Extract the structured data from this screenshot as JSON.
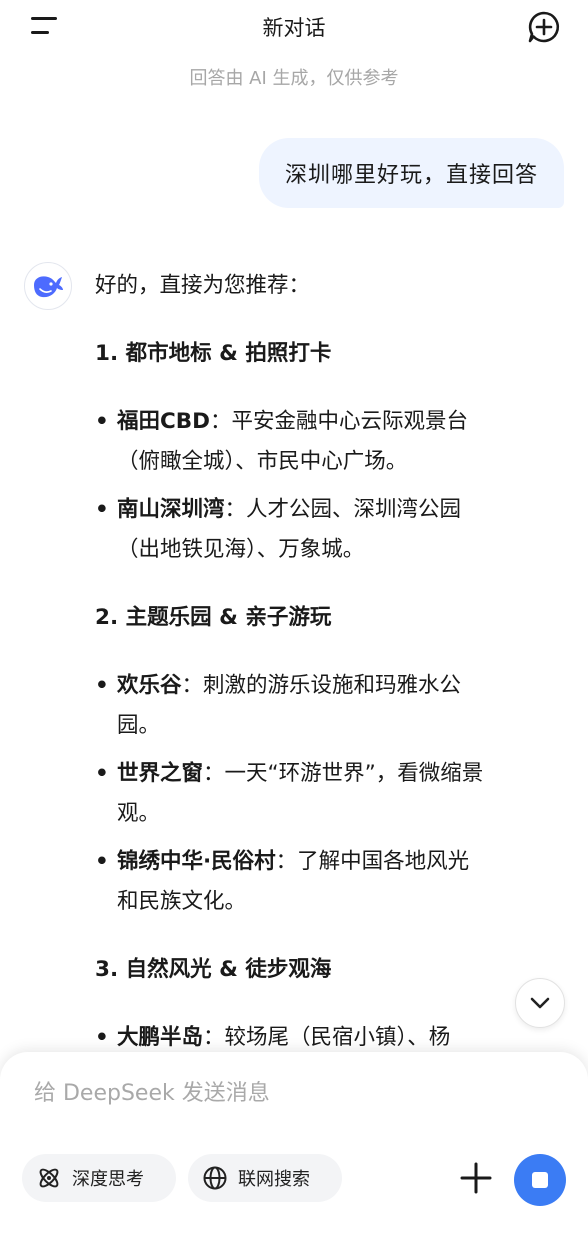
{
  "header": {
    "title": "新对话",
    "subtitle": "回答由 AI 生成，仅供参考"
  },
  "user_message": "深圳哪里好玩，直接回答",
  "assistant": {
    "intro": "好的，直接为您推荐：",
    "sections": [
      {
        "heading": "1. 都市地标 & 拍照打卡",
        "items": [
          {
            "name": "福田CBD",
            "line1": "：平安金融中心云际观景台",
            "line2": "（俯瞰全城）、市民中心广场。"
          },
          {
            "name": "南山深圳湾",
            "line1": "：人才公园、深圳湾公园",
            "line2": "（出地铁见海）、万象城。"
          }
        ]
      },
      {
        "heading": "2. 主题乐园 & 亲子游玩",
        "items": [
          {
            "name": "欢乐谷",
            "line1": "：刺激的游乐设施和玛雅水公",
            "line2": "园。"
          },
          {
            "name": "世界之窗",
            "line1": "：一天“环游世界”，看微缩景",
            "line2": "观。"
          },
          {
            "name": "锦绣中华·民俗村",
            "line1": "：了解中国各地风光",
            "line2": "和民族文化。"
          }
        ]
      },
      {
        "heading": "3. 自然风光 & 徒步观海",
        "items": [
          {
            "name": "大鹏半岛",
            "line1": "：较场尾（民宿小镇）、杨",
            "line2": ""
          }
        ]
      }
    ]
  },
  "composer": {
    "placeholder": "给 DeepSeek 发送消息",
    "deep_think_label": "深度思考",
    "web_search_label": "联网搜索"
  },
  "colors": {
    "accent": "#3b7cf4",
    "user_bubble": "#eef4ff",
    "logo": "#4d6bfe"
  },
  "icons": [
    "menu-icon",
    "new-chat-icon",
    "deepseek-whale-icon",
    "chevron-down-icon",
    "atom-icon",
    "globe-icon",
    "plus-icon",
    "stop-icon"
  ]
}
